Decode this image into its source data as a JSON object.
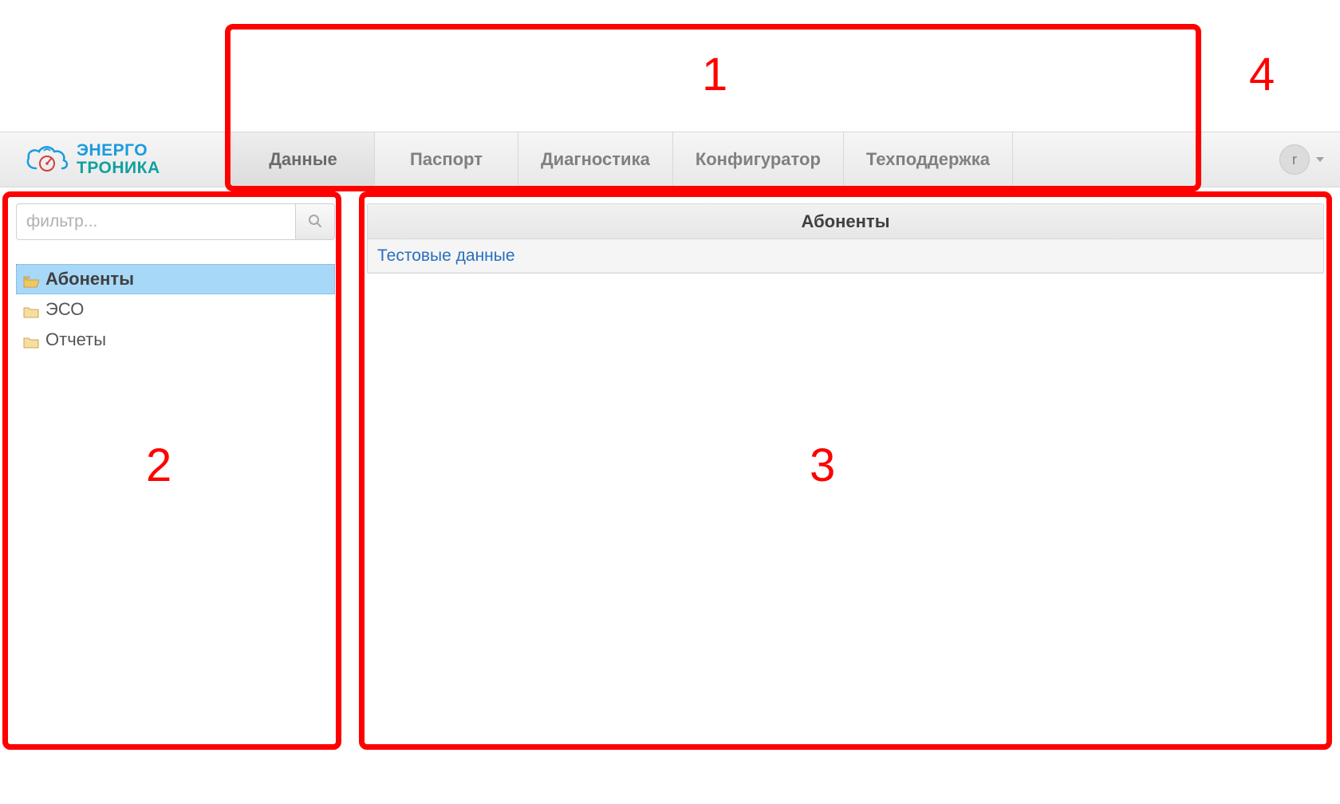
{
  "brand": {
    "line1": "ЭНЕРГО",
    "line2": "ТРОНИКА"
  },
  "header": {
    "tabs": [
      {
        "label": "Данные",
        "active": true
      },
      {
        "label": "Паспорт",
        "active": false
      },
      {
        "label": "Диагностика",
        "active": false
      },
      {
        "label": "Конфигуратор",
        "active": false
      },
      {
        "label": "Техподдержка",
        "active": false
      }
    ],
    "user_initial": "r"
  },
  "sidebar": {
    "filter_placeholder": "фильтр...",
    "items": [
      {
        "label": "Абоненты",
        "selected": true,
        "open": true
      },
      {
        "label": "ЭСО",
        "selected": false,
        "open": false
      },
      {
        "label": "Отчеты",
        "selected": false,
        "open": false
      }
    ]
  },
  "main": {
    "title": "Абоненты",
    "rows": [
      {
        "label": "Тестовые данные"
      }
    ]
  },
  "annotations": {
    "n1": "1",
    "n2": "2",
    "n3": "3",
    "n4": "4"
  }
}
